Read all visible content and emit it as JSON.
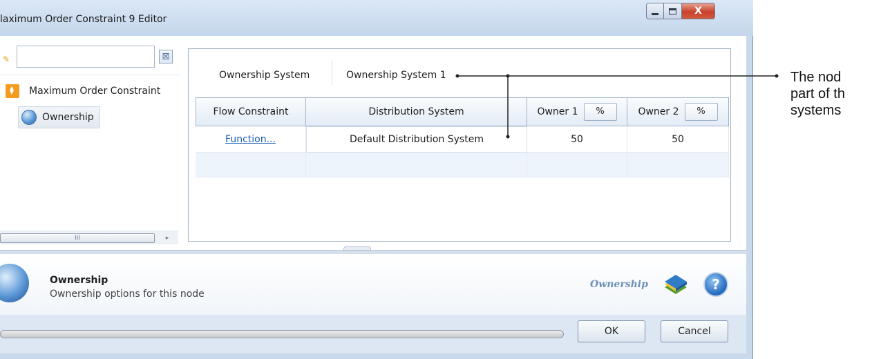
{
  "window": {
    "title": "laximum Order Constraint 9 Editor",
    "close_label": "X"
  },
  "left_pane": {
    "search": {
      "value": "",
      "placeholder": ""
    },
    "clear_label": "⊠",
    "tree": [
      {
        "label": "Maximum Order Constraint",
        "icon": "order-constraint-icon"
      },
      {
        "label": "Ownership",
        "icon": "globe-icon",
        "selected": true
      }
    ],
    "scroll_thumb_label": "III",
    "scroll_arrow": "▸"
  },
  "right_pane": {
    "system_label": "Ownership System",
    "system_value": "Ownership System 1",
    "grid": {
      "columns": [
        "Flow Constraint",
        "Distribution System",
        "Owner 1",
        "Owner 2"
      ],
      "pct_label": "%",
      "rows": [
        {
          "flow_constraint": "Function...",
          "distribution_system": "Default Distribution System",
          "owner1": "50",
          "owner2": "50"
        }
      ]
    }
  },
  "info": {
    "title": "Ownership",
    "description": "Ownership options for this node",
    "caption": "Ownership",
    "help_label": "?"
  },
  "buttons": {
    "ok": "OK",
    "cancel": "Cancel"
  },
  "callout": {
    "lines": [
      "The nod",
      "part of th",
      "systems"
    ]
  },
  "colors": {
    "accent": "#1a5fb4",
    "order_icon": "#f39c1f",
    "close_button": "#c8422d"
  }
}
